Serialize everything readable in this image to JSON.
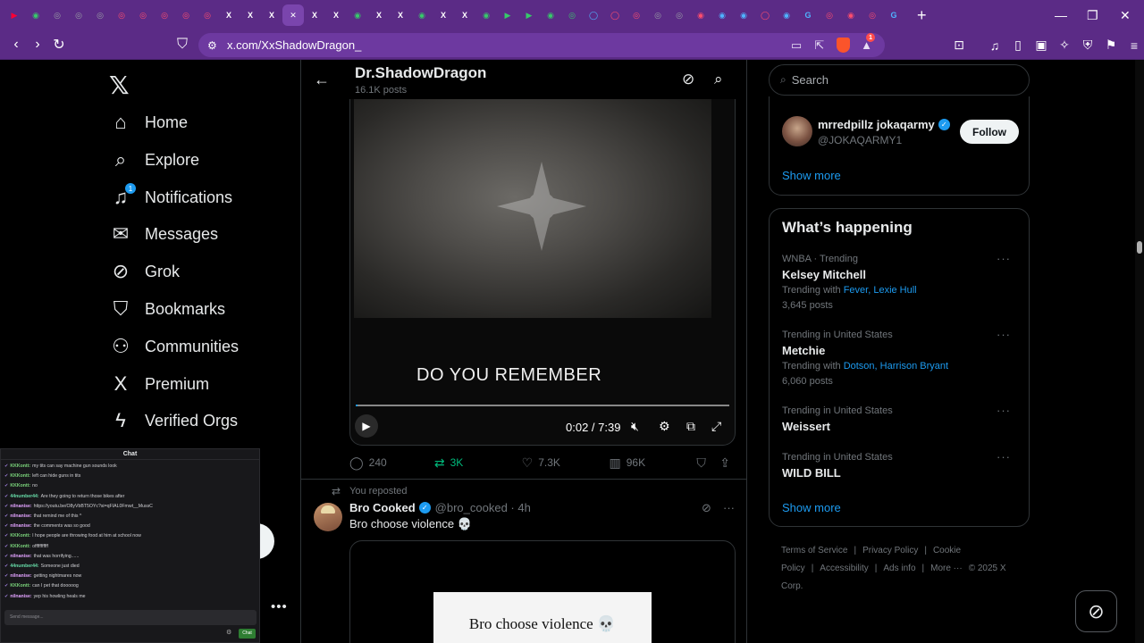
{
  "browser": {
    "tabs": [
      {
        "glyph": "▶",
        "color": "#ff0033"
      },
      {
        "glyph": "◉",
        "color": "#37c96a"
      },
      {
        "glyph": "◎",
        "color": "#9aa0a6"
      },
      {
        "glyph": "◎",
        "color": "#9aa0a6"
      },
      {
        "glyph": "◎",
        "color": "#9aa0a6"
      },
      {
        "glyph": "◎",
        "color": "#ff4d6d"
      },
      {
        "glyph": "◎",
        "color": "#ff4d6d"
      },
      {
        "glyph": "◎",
        "color": "#ff4d6d"
      },
      {
        "glyph": "◎",
        "color": "#ff4d6d"
      },
      {
        "glyph": "◎",
        "color": "#ff4d6d"
      },
      {
        "glyph": "X",
        "color": "#ffffff"
      },
      {
        "glyph": "X",
        "color": "#ffffff"
      },
      {
        "glyph": "X",
        "color": "#ffffff"
      },
      {
        "glyph": "✕",
        "color": "#ffffff",
        "active": true
      },
      {
        "glyph": "X",
        "color": "#ffffff"
      },
      {
        "glyph": "X",
        "color": "#ffffff"
      },
      {
        "glyph": "◉",
        "color": "#37c96a"
      },
      {
        "glyph": "X",
        "color": "#ffffff"
      },
      {
        "glyph": "X",
        "color": "#ffffff"
      },
      {
        "glyph": "◉",
        "color": "#37c96a"
      },
      {
        "glyph": "X",
        "color": "#ffffff"
      },
      {
        "glyph": "X",
        "color": "#ffffff"
      },
      {
        "glyph": "◉",
        "color": "#37c96a"
      },
      {
        "glyph": "▶",
        "color": "#37c96a"
      },
      {
        "glyph": "▶",
        "color": "#37c96a"
      },
      {
        "glyph": "◉",
        "color": "#37c96a"
      },
      {
        "glyph": "◎",
        "color": "#37c96a"
      },
      {
        "glyph": "◯",
        "color": "#4fb3ff"
      },
      {
        "glyph": "◯",
        "color": "#ff4d6d"
      },
      {
        "glyph": "◎",
        "color": "#ff4d6d"
      },
      {
        "glyph": "◎",
        "color": "#9aa0a6"
      },
      {
        "glyph": "◎",
        "color": "#9aa0a6"
      },
      {
        "glyph": "◉",
        "color": "#ff4d6d"
      },
      {
        "glyph": "◉",
        "color": "#4fb3ff"
      },
      {
        "glyph": "◉",
        "color": "#4fb3ff"
      },
      {
        "glyph": "◯",
        "color": "#ff4d6d"
      },
      {
        "glyph": "◉",
        "color": "#4fb3ff"
      },
      {
        "glyph": "G",
        "color": "#4fb3ff"
      },
      {
        "glyph": "◎",
        "color": "#ff4d6d"
      },
      {
        "glyph": "◉",
        "color": "#ff4d6d"
      },
      {
        "glyph": "◎",
        "color": "#ff4d6d"
      },
      {
        "glyph": "G",
        "color": "#4fb3ff"
      }
    ],
    "url": "x.com/XxShadowDragon_",
    "shield_count": "1"
  },
  "nav": {
    "items": [
      {
        "label": "Home",
        "icon": "home-icon",
        "glyph": "⌂"
      },
      {
        "label": "Explore",
        "icon": "search-icon",
        "glyph": "⌕"
      },
      {
        "label": "Notifications",
        "icon": "bell-icon",
        "glyph": "♫",
        "badge": "1"
      },
      {
        "label": "Messages",
        "icon": "envelope-icon",
        "glyph": "✉"
      },
      {
        "label": "Grok",
        "icon": "grok-icon",
        "glyph": "⊘"
      },
      {
        "label": "Bookmarks",
        "icon": "bookmark-icon",
        "glyph": "⛉"
      },
      {
        "label": "Communities",
        "icon": "people-icon",
        "glyph": "⚇"
      },
      {
        "label": "Premium",
        "icon": "x-logo-icon",
        "glyph": "X"
      },
      {
        "label": "Verified Orgs",
        "icon": "lightning-icon",
        "glyph": "ϟ"
      }
    ]
  },
  "chat": {
    "title": "Chat",
    "input_placeholder": "Send message...",
    "send_label": "Chat",
    "messages": [
      {
        "user": "KKKontt:",
        "color": "#7cd67c",
        "text": "my tits can say machine gun sounds look"
      },
      {
        "user": "KKKontt:",
        "color": "#7cd67c",
        "text": "left can hide guns in tits"
      },
      {
        "user": "KKKontt:",
        "color": "#7cd67c",
        "text": "no"
      },
      {
        "user": "44number44:",
        "color": "#66d9a6",
        "text": "Are they going to return those bikes after"
      },
      {
        "user": "nilnanise:",
        "color": "#e2a2ff",
        "text": "https://youtu.be/O8yVbBT5OYc?si=qFIAL0Fmwt__MussC"
      },
      {
        "user": "nilnanise:",
        "color": "#e2a2ff",
        "text": "that remind me of this ^"
      },
      {
        "user": "nilnanise:",
        "color": "#e2a2ff",
        "text": "the comments was so good"
      },
      {
        "user": "KKKontt:",
        "color": "#7cd67c",
        "text": "I hope people are throwing food at him at school now"
      },
      {
        "user": "KKKontt:",
        "color": "#7cd67c",
        "text": "offfffffffff"
      },
      {
        "user": "nilnanise:",
        "color": "#e2a2ff",
        "text": "that was horrifying......"
      },
      {
        "user": "44number44:",
        "color": "#66d9a6",
        "text": "Someone just died"
      },
      {
        "user": "nilnanise:",
        "color": "#e2a2ff",
        "text": "getting nightmares now"
      },
      {
        "user": "KKKontt:",
        "color": "#7cd67c",
        "text": "can I pet that dooooog"
      },
      {
        "user": "nilnanise:",
        "color": "#e2a2ff",
        "text": "yep his howling heals me"
      }
    ]
  },
  "profile": {
    "name": "Dr.ShadowDragon",
    "posts": "16.1K posts"
  },
  "video": {
    "caption": "DO YOU REMEMBER",
    "time": "0:02 / 7:39",
    "progress": 0.005
  },
  "post1_actions": {
    "replies": "240",
    "reposts": "3K",
    "likes": "7.3K",
    "views": "96K"
  },
  "post2": {
    "repost_label": "You reposted",
    "author": "Bro Cooked",
    "handle": "@bro_cooked · 4h",
    "text": "Bro choose violence 💀",
    "meme_text": "Bro choose violence 💀"
  },
  "right": {
    "search_placeholder": "Search",
    "who_to_follow": {
      "name": "mrredpillz jokaqarmy",
      "handle": "@JOKAQARMY1",
      "follow_label": "Follow",
      "show_more": "Show more"
    },
    "trends_title": "What’s happening",
    "trends": [
      {
        "context": "WNBA · Trending",
        "name": "Kelsey Mitchell",
        "with_label": "Trending with",
        "with": [
          "Fever",
          "Lexie Hull"
        ],
        "count": "3,645 posts"
      },
      {
        "context": "Trending in United States",
        "name": "Metchie",
        "with_label": "Trending with",
        "with": [
          "Dotson",
          "Harrison Bryant"
        ],
        "count": "6,060 posts"
      },
      {
        "context": "Trending in United States",
        "name": "Weissert",
        "with_label": "",
        "with": [],
        "count": ""
      },
      {
        "context": "Trending in United States",
        "name": "WILD BILL",
        "with_label": "",
        "with": [],
        "count": ""
      }
    ],
    "trends_show_more": "Show more",
    "footer": [
      "Terms of Service",
      "|",
      "Privacy Policy",
      "|",
      "Cookie Policy",
      "|",
      "Accessibility",
      "|",
      "Ads info",
      "|",
      "More ···",
      "© 2025 X Corp."
    ]
  }
}
